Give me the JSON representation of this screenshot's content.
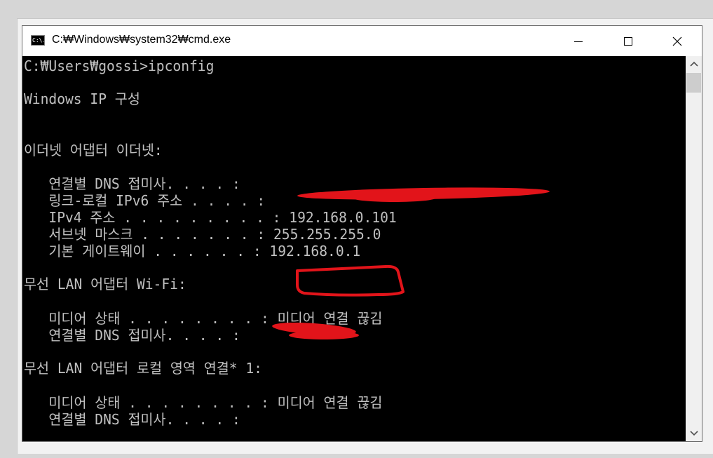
{
  "window": {
    "title": "C:₩Windows₩system32₩cmd.exe",
    "icon_text": "C:\\.",
    "controls": {
      "minimize_icon": "minimize-icon",
      "maximize_icon": "maximize-icon",
      "close_icon": "close-icon"
    }
  },
  "console": {
    "lines": [
      "C:₩Users₩gossi>ipconfig",
      "Windows IP 구성",
      "이더넷 어댑터 이더넷:",
      "   연결별 DNS 접미사. . . . :",
      "   링크-로컬 IPv6 주소 . . . . :",
      "   IPv4 주소 . . . . . . . . . : 192.168.0.101",
      "   서브넷 마스크 . . . . . . . : 255.255.255.0",
      "   기본 게이트웨이 . . . . . . : 192.168.0.1",
      "무선 LAN 어댑터 Wi-Fi:",
      "   미디어 상태 . . . . . . . . : 미디어 연결 끊김",
      "   연결별 DNS 접미사. . . . :",
      "무선 LAN 어댑터 로컬 영역 연결* 1:",
      "   미디어 상태 . . . . . . . . : 미디어 연결 끊김",
      "   연결별 DNS 접미사. . . . :"
    ]
  },
  "colors": {
    "console_bg": "#000000",
    "console_text": "#c0c0c0",
    "annotation_red": "#e2141a"
  }
}
